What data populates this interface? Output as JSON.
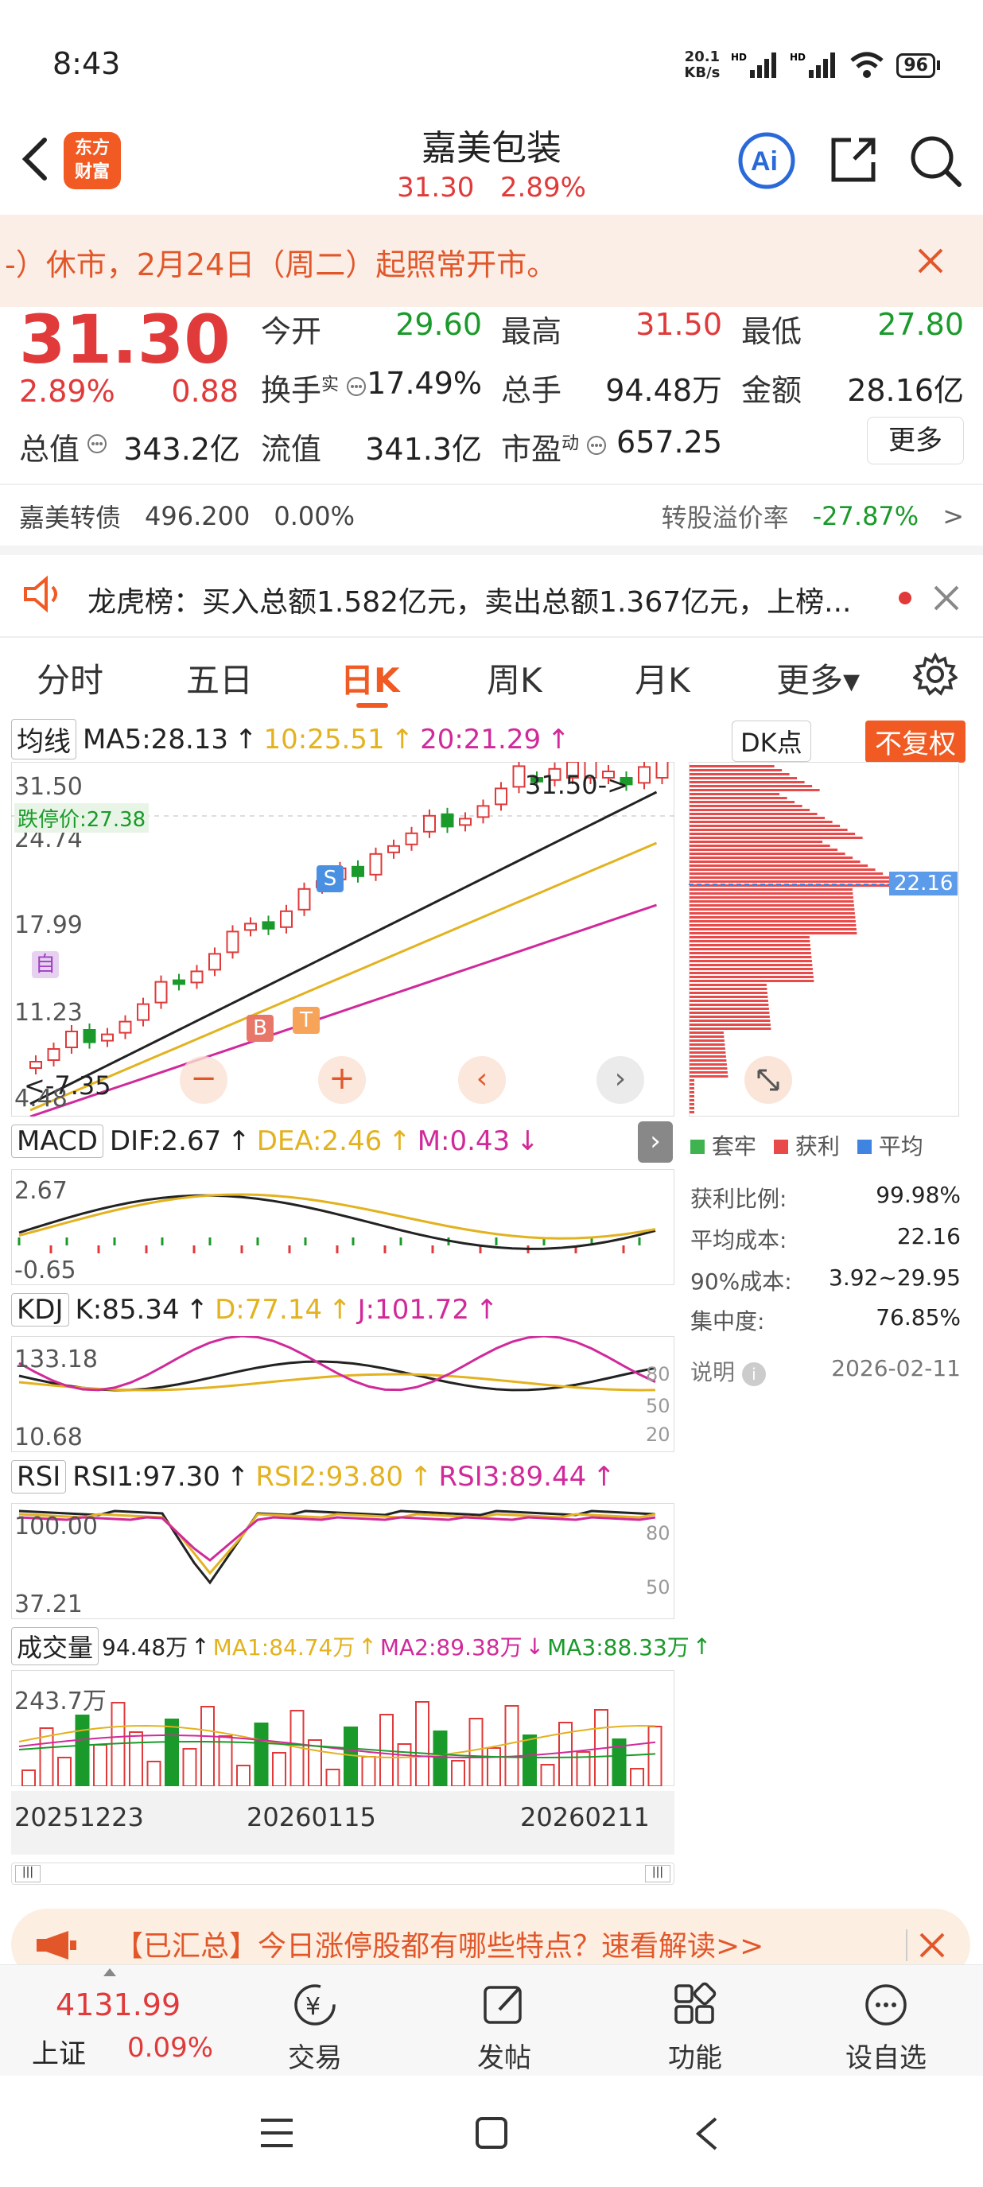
{
  "status": {
    "time": "8:43",
    "net_speed_top": "20.1",
    "net_speed_bottom": "KB/s",
    "battery": "96"
  },
  "header": {
    "logo_line1": "东方",
    "logo_line2": "财富",
    "title": "嘉美包装",
    "price": "31.30",
    "change_pct": "2.89%"
  },
  "notice": {
    "text": "-）休市，2月24日（周二）起照常开市。"
  },
  "quote": {
    "price": "31.30",
    "change_pct": "2.89%",
    "change": "0.88",
    "open_label": "今开",
    "open": "29.60",
    "high_label": "最高",
    "high": "31.50",
    "low_label": "最低",
    "low": "27.80",
    "turnover_label": "换手",
    "turnover_sup": "实",
    "turnover": "17.49%",
    "volume_label": "总手",
    "volume": "94.48万",
    "amount_label": "金额",
    "amount": "28.16亿",
    "mcap_label": "总值",
    "mcap": "343.2亿",
    "float_label": "流值",
    "float": "341.3亿",
    "pe_label": "市盈",
    "pe_sup": "动",
    "pe": "657.25",
    "more": "更多",
    "bond_label": "嘉美转债",
    "bond_price": "496.200",
    "bond_change": "0.00%",
    "premium_label": "转股溢价率",
    "premium": "-27.87%"
  },
  "lhb": {
    "text": "龙虎榜：买入总额1.582亿元，卖出总额1.367亿元，上榜..."
  },
  "tabs": [
    "分时",
    "五日",
    "日K",
    "周K",
    "月K",
    "更多▾"
  ],
  "active_tab": 2,
  "kline": {
    "ma_selector": "均线",
    "ma5": "MA5:28.13",
    "ma10": "10:25.51",
    "ma20": "20:21.29",
    "dk_button": "DK点",
    "fq_button": "不复权",
    "y_labels": [
      "31.50",
      "24.74",
      "17.99",
      "11.23",
      "4.48"
    ],
    "limit_down": "跌停价:27.38",
    "max_marker": "31.50->",
    "min_marker": "<-7.35",
    "markers": {
      "b": "B",
      "s": "S",
      "t": "T",
      "zi": "自"
    }
  },
  "macd": {
    "name": "MACD",
    "dif": "DIF:2.67",
    "dea": "DEA:2.46",
    "m": "M:0.43",
    "top": "2.67",
    "bottom": "-0.65"
  },
  "kdj": {
    "name": "KDJ",
    "k": "K:85.34",
    "d": "D:77.14",
    "j": "J:101.72",
    "top": "133.18",
    "bottom": "10.68",
    "levels": [
      "80",
      "50",
      "20"
    ]
  },
  "rsi": {
    "name": "RSI",
    "rsi1": "RSI1:97.30",
    "rsi2": "RSI2:93.80",
    "rsi3": "RSI3:89.44",
    "top": "100.00",
    "bottom": "37.21",
    "levels": [
      "80",
      "50"
    ]
  },
  "vol": {
    "name": "成交量",
    "v": "94.48万",
    "ma1": "MA1:84.74万",
    "ma2": "MA2:89.38万",
    "ma3": "MA3:88.33万",
    "top": "243.7万"
  },
  "dates": [
    "20251223",
    "20260115",
    "20260211"
  ],
  "dist": {
    "avg_tag": "22.16",
    "legend": [
      "套牢",
      "获利",
      "平均"
    ],
    "rows": [
      {
        "k": "获利比例:",
        "v": "99.98%"
      },
      {
        "k": "平均成本:",
        "v": "22.16"
      },
      {
        "k": "90%成本:",
        "v": "3.92~29.95"
      },
      {
        "k": "集中度:",
        "v": "76.85%"
      }
    ],
    "note": "说明",
    "date": "2026-02-11"
  },
  "promo": {
    "text": "【已汇总】今日涨停股都有哪些特点？速看解读>>"
  },
  "bottom": {
    "index_value": "4131.99",
    "index_name": "上证",
    "index_change": "0.09%",
    "items": [
      "交易",
      "发帖",
      "功能",
      "设自选"
    ]
  },
  "colors": {
    "up": "#e03a3a",
    "down": "#1a9a2a",
    "accent": "#f15a22"
  }
}
